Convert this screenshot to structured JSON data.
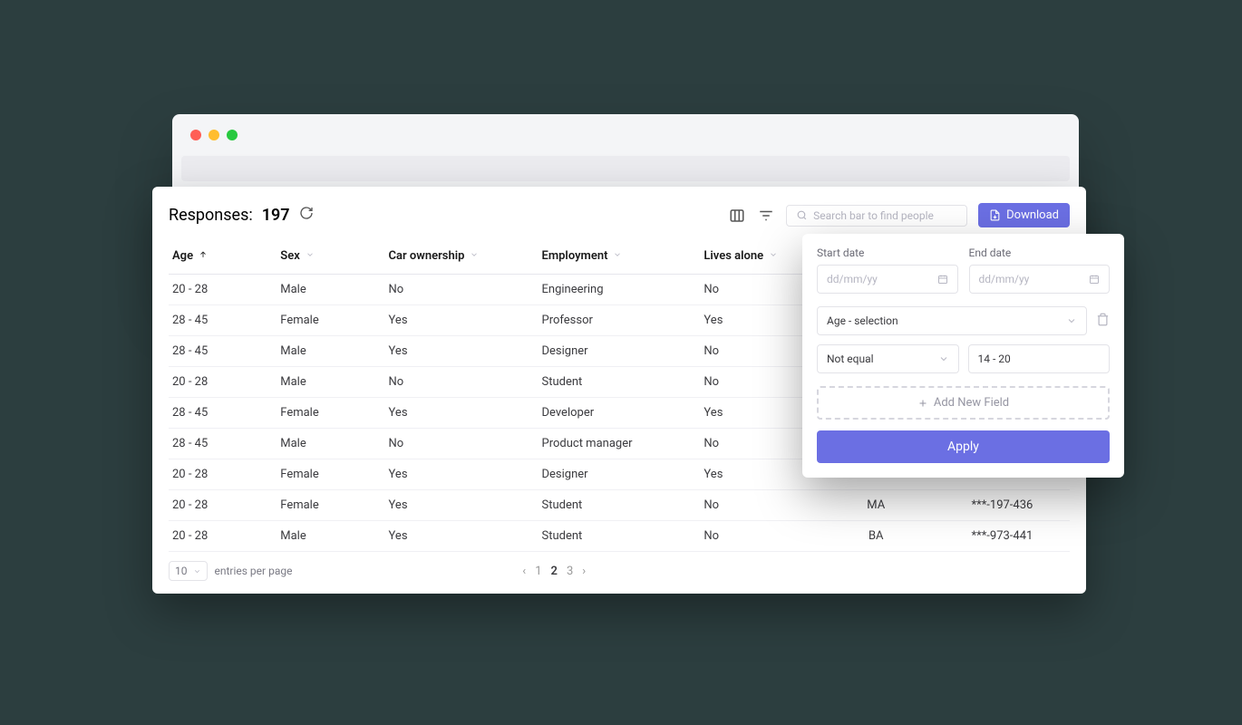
{
  "responses": {
    "label": "Responses:",
    "count": "197"
  },
  "search": {
    "placeholder": "Search bar to find people"
  },
  "download_label": "Download",
  "columns": {
    "age": "Age",
    "sex": "Sex",
    "car": "Car ownership",
    "employment": "Employment",
    "lives_alone": "Lives alone",
    "degree": "",
    "phone": ""
  },
  "rows": [
    {
      "age": "20 - 28",
      "sex": "Male",
      "car": "No",
      "employment": "Engineering",
      "lives": "No",
      "degree": "",
      "phone": ""
    },
    {
      "age": "28 - 45",
      "sex": "Female",
      "car": "Yes",
      "employment": "Professor",
      "lives": "Yes",
      "degree": "",
      "phone": ""
    },
    {
      "age": "28 - 45",
      "sex": "Male",
      "car": "Yes",
      "employment": "Designer",
      "lives": "No",
      "degree": "",
      "phone": ""
    },
    {
      "age": "20 - 28",
      "sex": "Male",
      "car": "No",
      "employment": "Student",
      "lives": "No",
      "degree": "",
      "phone": ""
    },
    {
      "age": "28 - 45",
      "sex": "Female",
      "car": "Yes",
      "employment": "Developer",
      "lives": "Yes",
      "degree": "",
      "phone": ""
    },
    {
      "age": "28 - 45",
      "sex": "Male",
      "car": "No",
      "employment": "Product manager",
      "lives": "No",
      "degree": "",
      "phone": ""
    },
    {
      "age": "20 - 28",
      "sex": "Female",
      "car": "Yes",
      "employment": "Designer",
      "lives": "Yes",
      "degree": "",
      "phone": ""
    },
    {
      "age": "20 - 28",
      "sex": "Female",
      "car": "Yes",
      "employment": "Student",
      "lives": "No",
      "degree": "MA",
      "phone": "***-197-436"
    },
    {
      "age": "20 - 28",
      "sex": "Male",
      "car": "Yes",
      "employment": "Student",
      "lives": "No",
      "degree": "BA",
      "phone": "***-973-441"
    }
  ],
  "pagination": {
    "entries_value": "10",
    "entries_label": "entries per page",
    "pages": [
      "1",
      "2",
      "3"
    ],
    "active": "2"
  },
  "filter": {
    "start_label": "Start date",
    "end_label": "End date",
    "date_placeholder": "dd/mm/yy",
    "field_select": "Age - selection",
    "operator": "Not equal",
    "value": "14 - 20",
    "add_field_label": "Add New Field",
    "apply_label": "Apply"
  }
}
